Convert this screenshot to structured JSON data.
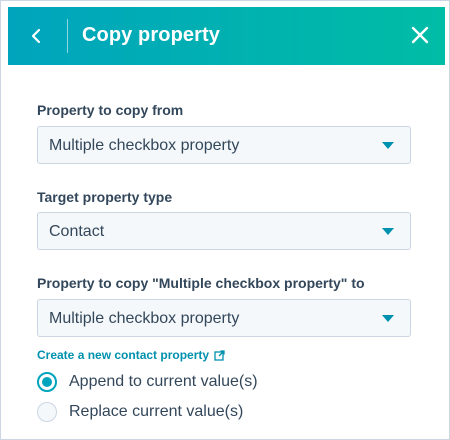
{
  "header": {
    "title": "Copy property",
    "back_icon": "chevron-left-icon",
    "close_icon": "close-icon",
    "gradient_start": "#00a4bd",
    "gradient_end": "#00bda5"
  },
  "fields": {
    "source": {
      "label": "Property to copy from",
      "value": "Multiple checkbox property"
    },
    "target_type": {
      "label": "Target property type",
      "value": "Contact"
    },
    "destination": {
      "label": "Property to copy \"Multiple checkbox property\" to",
      "value": "Multiple checkbox property"
    }
  },
  "create_link": {
    "label": "Create a new contact property",
    "icon": "external-link-icon"
  },
  "options": [
    {
      "label": "Append to current value(s)",
      "checked": true
    },
    {
      "label": "Replace current value(s)",
      "checked": false
    }
  ],
  "colors": {
    "accent": "#00a4bd",
    "link": "#0091ae",
    "text": "#33475b"
  }
}
